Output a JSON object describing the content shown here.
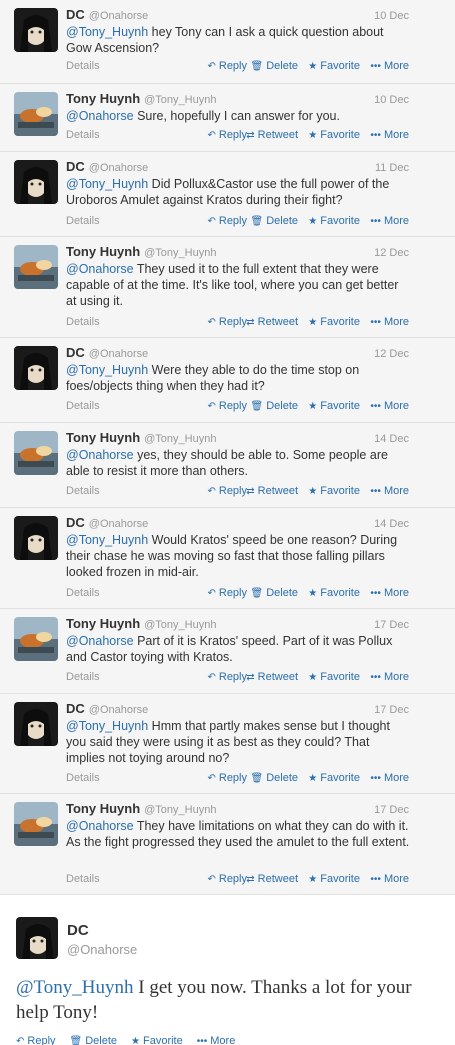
{
  "users": {
    "dc": {
      "name": "DC",
      "handle": "@Onahorse"
    },
    "tony": {
      "name": "Tony Huynh",
      "handle": "@Tony_Huynh"
    }
  },
  "labels": {
    "details": "Details",
    "reply": "Reply",
    "delete": "Delete",
    "retweet": "Retweet",
    "favorite": "Favorite",
    "more": "More"
  },
  "tweets": [
    {
      "user": "dc",
      "date": "10 Dec",
      "mention": "@Tony_Huynh",
      "text": " hey Tony can I ask a quick question about Gow Ascension?"
    },
    {
      "user": "tony",
      "date": "10 Dec",
      "mention": "@Onahorse",
      "text": " Sure, hopefully I can answer for you."
    },
    {
      "user": "dc",
      "date": "11 Dec",
      "mention": "@Tony_Huynh",
      "text": " Did Pollux&Castor use the full power of the Uroboros Amulet against Kratos during their fight?"
    },
    {
      "user": "tony",
      "date": "12 Dec",
      "mention": "@Onahorse",
      "text": " They used it to the full extent that they were capable of at the time. It's like tool, where you can get better at using it."
    },
    {
      "user": "dc",
      "date": "12 Dec",
      "mention": "@Tony_Huynh",
      "text": " Were they able to do the time stop on foes/objects thing when they had it?"
    },
    {
      "user": "tony",
      "date": "14 Dec",
      "mention": "@Onahorse",
      "text": " yes, they should be able to. Some people are able to resist it more than others."
    },
    {
      "user": "dc",
      "date": "14 Dec",
      "mention": "@Tony_Huynh",
      "text": " Would Kratos' speed be one reason? During their chase he was moving so fast that those falling pillars looked frozen in mid-air."
    },
    {
      "user": "tony",
      "date": "17 Dec",
      "mention": "@Onahorse",
      "text": " Part of it is Kratos' speed.  Part of it was Pollux and Castor toying with Kratos."
    },
    {
      "user": "dc",
      "date": "17 Dec",
      "mention": "@Tony_Huynh",
      "text": " Hmm that partly makes sense but I thought you said they were using it as best as they could? That implies not toying around no?"
    },
    {
      "user": "tony",
      "date": "17 Dec",
      "mention": "@Onahorse",
      "text": " They have limitations on what they can do with it. As the fight progressed they used the amulet to the full extent."
    }
  ],
  "final_tweet": {
    "user": "dc",
    "mention": "@Tony_Huynh",
    "text": " I get you now. Thanks a lot for your help Tony!"
  },
  "colors": {
    "link": "#2b6fad",
    "muted": "#999999",
    "row_bg": "#f5f5f5"
  }
}
